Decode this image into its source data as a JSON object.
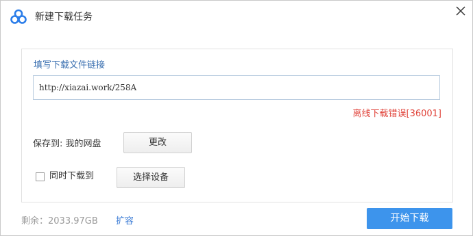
{
  "window": {
    "title": "新建下载任务",
    "icon": "baidu-netdisk-cloud-icon",
    "close_icon": "close-icon"
  },
  "link_section": {
    "label": "填写下载文件链接",
    "url_value": "http://xiazai.work/258A",
    "error_message": "离线下载错误[36001]"
  },
  "save": {
    "label": "保存到: 我的网盘",
    "change_button": "更改"
  },
  "device": {
    "checkbox_label": "同时下载到",
    "checked": false,
    "select_button": "选择设备"
  },
  "footer": {
    "remaining": "剩余：2033.97GB",
    "expand_link": "扩容",
    "start_button": "开始下载"
  },
  "colors": {
    "accent": "#3d94ec",
    "error": "#e0433a",
    "link": "#3a7bd5",
    "label_blue": "#3a6fb0"
  }
}
